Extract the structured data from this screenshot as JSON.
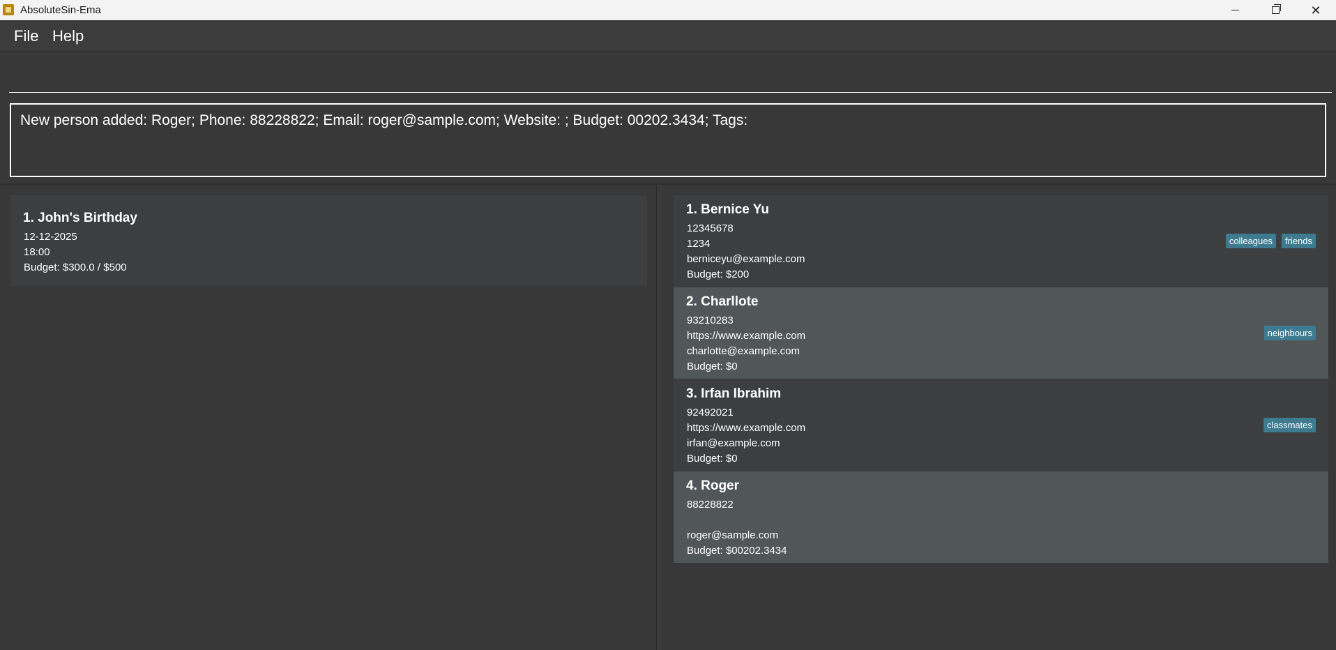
{
  "window": {
    "title": "AbsoluteSin-Ema",
    "controls": {
      "minimize": "—",
      "maximize": "❐",
      "close": "✕"
    }
  },
  "menu": {
    "file": "File",
    "help": "Help"
  },
  "command": {
    "value": "",
    "placeholder": ""
  },
  "result": {
    "text": "New person added: Roger; Phone: 88228822; Email: roger@sample.com; Website: ; Budget: 00202.3434; Tags:"
  },
  "events": [
    {
      "title": "1. John's Birthday",
      "date": "12-12-2025",
      "time": "18:00",
      "budget": "Budget: $300.0 / $500"
    }
  ],
  "persons": [
    {
      "name": "1. Bernice Yu",
      "phone": "12345678",
      "website": "1234",
      "email": "berniceyu@example.com",
      "budget": "Budget: $200",
      "tags": [
        "colleagues",
        "friends"
      ]
    },
    {
      "name": "2. Charllote",
      "phone": "93210283",
      "website": "https://www.example.com",
      "email": "charlotte@example.com",
      "budget": "Budget: $0",
      "tags": [
        "neighbours"
      ]
    },
    {
      "name": "3. Irfan Ibrahim",
      "phone": "92492021",
      "website": "https://www.example.com",
      "email": "irfan@example.com",
      "budget": "Budget: $0",
      "tags": [
        "classmates"
      ]
    },
    {
      "name": "4. Roger",
      "phone": "88228822",
      "website": "",
      "email": "roger@sample.com",
      "budget": "Budget: $00202.3434",
      "tags": []
    }
  ],
  "colors": {
    "background": "#383838",
    "card_odd": "#3c3e40",
    "card_even": "#515658",
    "tag": "#3e7b91"
  }
}
